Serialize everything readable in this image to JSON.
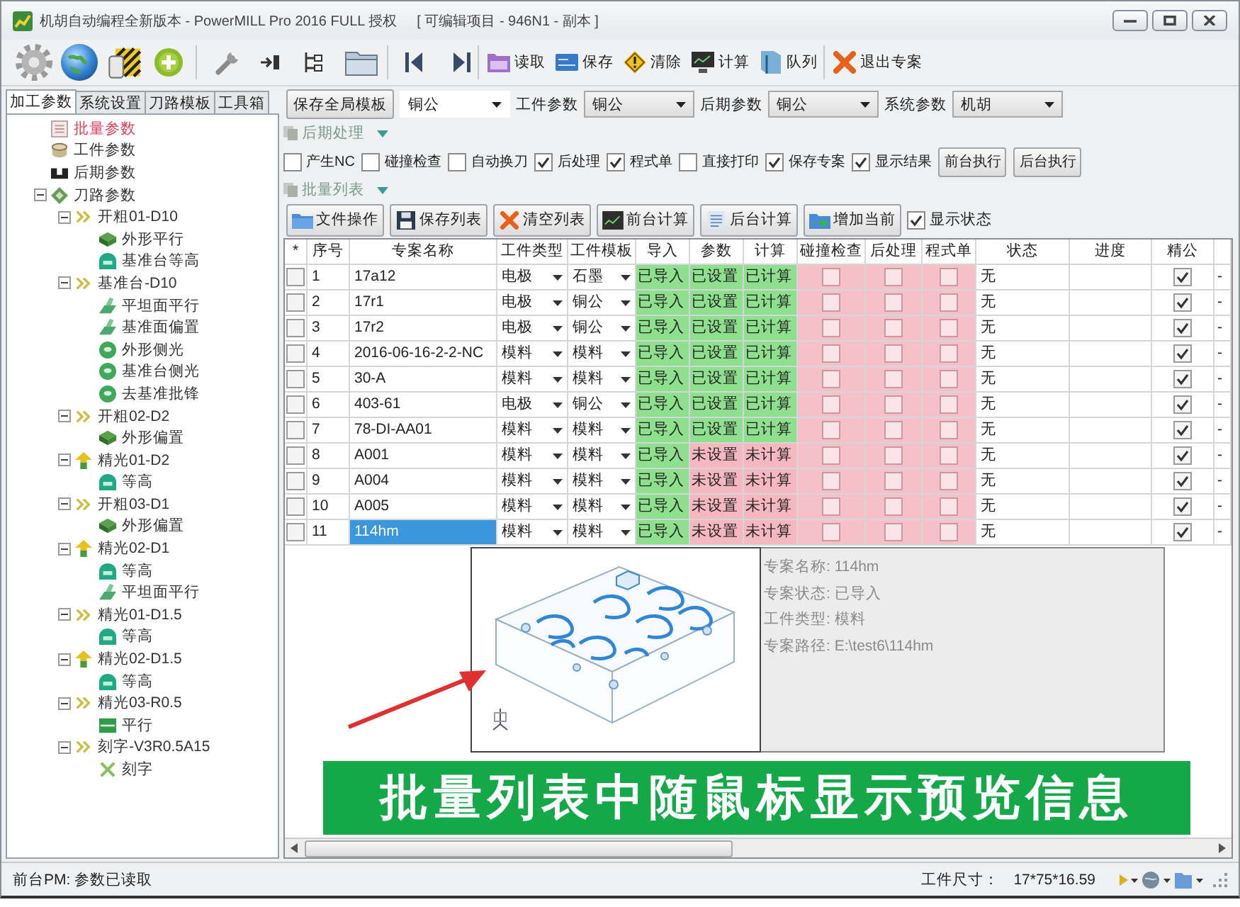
{
  "window": {
    "title": "机胡自动编程全新版本 - PowerMILL Pro 2016 FULL 授权",
    "subtitle": "[ 可编辑项目 - 946N1 - 副本 ]"
  },
  "toolbar": {
    "buttons": [
      {
        "label": "读取",
        "kind": "open"
      },
      {
        "label": "保存",
        "kind": "save"
      },
      {
        "label": "清除",
        "kind": "clear"
      },
      {
        "label": "计算",
        "kind": "compute"
      },
      {
        "label": "队列",
        "kind": "queue"
      },
      {
        "label": "退出专案",
        "kind": "exit"
      }
    ]
  },
  "left_tabs": [
    {
      "label": "加工参数",
      "selected": true
    },
    {
      "label": "系统设置",
      "selected": false
    },
    {
      "label": "刀路模板",
      "selected": false
    },
    {
      "label": "工具箱",
      "selected": false
    }
  ],
  "tree": [
    {
      "label": "批量参数",
      "kind": "batch",
      "selected": true
    },
    {
      "label": "工件参数",
      "kind": "workpiece",
      "selected": false
    },
    {
      "label": "后期参数",
      "kind": "post",
      "selected": false
    },
    {
      "label": "刀路参数",
      "kind": "toolpath",
      "selected": false,
      "expanded": true,
      "children": [
        {
          "label": "开粗01-D10",
          "kind": "rough",
          "selected": false,
          "expanded": true,
          "children": [
            {
              "label": "外形平行",
              "kind": "layers",
              "selected": false
            },
            {
              "label": "基准台等高",
              "kind": "dome",
              "selected": false
            }
          ]
        },
        {
          "label": "基准台-D10",
          "kind": "rough",
          "selected": false,
          "expanded": true,
          "children": [
            {
              "label": "平坦面平行",
              "kind": "plane",
              "selected": false
            },
            {
              "label": "基准面偏置",
              "kind": "plane",
              "selected": false
            },
            {
              "label": "外形侧光",
              "kind": "ring",
              "selected": false
            },
            {
              "label": "基准台侧光",
              "kind": "ring",
              "selected": false
            },
            {
              "label": "去基准批锋",
              "kind": "ring",
              "selected": false
            }
          ]
        },
        {
          "label": "开粗02-D2",
          "kind": "rough",
          "selected": false,
          "expanded": true,
          "children": [
            {
              "label": "外形偏置",
              "kind": "layers",
              "selected": false
            }
          ]
        },
        {
          "label": "精光01-D2",
          "kind": "finish",
          "selected": false,
          "expanded": true,
          "children": [
            {
              "label": "等高",
              "kind": "dome",
              "selected": false
            }
          ]
        },
        {
          "label": "开粗03-D1",
          "kind": "rough",
          "selected": false,
          "expanded": true,
          "children": [
            {
              "label": "外形偏置",
              "kind": "layers",
              "selected": false
            }
          ]
        },
        {
          "label": "精光02-D1",
          "kind": "finish",
          "selected": false,
          "expanded": true,
          "children": [
            {
              "label": "等高",
              "kind": "dome",
              "selected": false
            },
            {
              "label": "平坦面平行",
              "kind": "plane",
              "selected": false
            }
          ]
        },
        {
          "label": "精光01-D1.5",
          "kind": "rough",
          "selected": false,
          "expanded": true,
          "children": [
            {
              "label": "等高",
              "kind": "dome",
              "selected": false
            }
          ]
        },
        {
          "label": "精光02-D1.5",
          "kind": "finish",
          "selected": false,
          "expanded": true,
          "children": [
            {
              "label": "等高",
              "kind": "dome",
              "selected": false
            }
          ]
        },
        {
          "label": "精光03-R0.5",
          "kind": "rough",
          "selected": false,
          "expanded": true,
          "children": [
            {
              "label": "平行",
              "kind": "panel",
              "selected": false
            }
          ]
        },
        {
          "label": "刻字-V3R0.5A15",
          "kind": "rough",
          "selected": false,
          "expanded": true,
          "children": [
            {
              "label": "刻字",
              "kind": "engrave",
              "selected": false
            }
          ]
        }
      ]
    }
  ],
  "template_bar": {
    "button": "保存全局模板",
    "selectors": [
      {
        "value": "铜公"
      },
      {
        "label": "工件参数",
        "value": "铜公"
      },
      {
        "label": "后期参数",
        "value": "铜公"
      },
      {
        "label": "系统参数",
        "value": "机胡"
      }
    ]
  },
  "post_section": {
    "title": "后期处理",
    "expanded": true,
    "options": [
      {
        "label": "产生NC",
        "checked": false
      },
      {
        "label": "碰撞检查",
        "checked": false
      },
      {
        "label": "自动换刀",
        "checked": false
      },
      {
        "label": "后处理",
        "checked": true
      },
      {
        "label": "程式单",
        "checked": true
      },
      {
        "label": "直接打印",
        "checked": false
      },
      {
        "label": "保存专案",
        "checked": true
      },
      {
        "label": "显示结果",
        "checked": true
      }
    ],
    "buttons": [
      "前台执行",
      "后台执行"
    ]
  },
  "batch_section": {
    "title": "批量列表",
    "expanded": true,
    "buttons": [
      {
        "label": "文件操作",
        "kind": "files"
      },
      {
        "label": "保存列表",
        "kind": "save"
      },
      {
        "label": "清空列表",
        "kind": "clear"
      },
      {
        "label": "前台计算",
        "kind": "foreground"
      },
      {
        "label": "后台计算",
        "kind": "background"
      },
      {
        "label": "增加当前",
        "kind": "add"
      }
    ],
    "show_status": {
      "label": "显示状态",
      "checked": true
    }
  },
  "table": {
    "columns": [
      "*",
      "序号",
      "专案名称",
      "工件类型",
      "工件模板",
      "导入",
      "参数",
      "计算",
      "碰撞检查",
      "后处理",
      "程式单",
      "状态",
      "进度",
      "精公"
    ],
    "rows": [
      {
        "checked": false,
        "no": "1",
        "name": "17a12",
        "selected": false,
        "type": "电极",
        "template": "石墨",
        "import": {
          "text": "已导入",
          "done": true
        },
        "params": {
          "text": "已设置",
          "done": true
        },
        "calc": {
          "text": "已计算",
          "done": true
        },
        "collision": false,
        "post": false,
        "program": false,
        "status": "无",
        "finish_electrode": true,
        "column_15": "-"
      },
      {
        "checked": false,
        "no": "2",
        "name": "17r1",
        "selected": false,
        "type": "电极",
        "template": "铜公",
        "import": {
          "text": "已导入",
          "done": true
        },
        "params": {
          "text": "已设置",
          "done": true
        },
        "calc": {
          "text": "已计算",
          "done": true
        },
        "collision": false,
        "post": false,
        "program": false,
        "status": "无",
        "finish_electrode": true,
        "column_15": "-"
      },
      {
        "checked": false,
        "no": "3",
        "name": "17r2",
        "selected": false,
        "type": "电极",
        "template": "铜公",
        "import": {
          "text": "已导入",
          "done": true
        },
        "params": {
          "text": "已设置",
          "done": true
        },
        "calc": {
          "text": "已计算",
          "done": true
        },
        "collision": false,
        "post": false,
        "program": false,
        "status": "无",
        "finish_electrode": true,
        "column_15": "-"
      },
      {
        "checked": false,
        "no": "4",
        "name": "2016-06-16-2-2-NC",
        "selected": false,
        "type": "模料",
        "template": "模料",
        "import": {
          "text": "已导入",
          "done": true
        },
        "params": {
          "text": "已设置",
          "done": true
        },
        "calc": {
          "text": "已计算",
          "done": true
        },
        "collision": false,
        "post": false,
        "program": false,
        "status": "无",
        "finish_electrode": true,
        "column_15": "-"
      },
      {
        "checked": false,
        "no": "5",
        "name": "30-A",
        "selected": false,
        "type": "模料",
        "template": "模料",
        "import": {
          "text": "已导入",
          "done": true
        },
        "params": {
          "text": "已设置",
          "done": true
        },
        "calc": {
          "text": "已计算",
          "done": true
        },
        "collision": false,
        "post": false,
        "program": false,
        "status": "无",
        "finish_electrode": true,
        "column_15": "-"
      },
      {
        "checked": false,
        "no": "6",
        "name": "403-61",
        "selected": false,
        "type": "电极",
        "template": "铜公",
        "import": {
          "text": "已导入",
          "done": true
        },
        "params": {
          "text": "已设置",
          "done": true
        },
        "calc": {
          "text": "已计算",
          "done": true
        },
        "collision": false,
        "post": false,
        "program": false,
        "status": "无",
        "finish_electrode": true,
        "column_15": "-"
      },
      {
        "checked": false,
        "no": "7",
        "name": "78-DI-AA01",
        "selected": false,
        "type": "模料",
        "template": "模料",
        "import": {
          "text": "已导入",
          "done": true
        },
        "params": {
          "text": "已设置",
          "done": true
        },
        "calc": {
          "text": "已计算",
          "done": true
        },
        "collision": false,
        "post": false,
        "program": false,
        "status": "无",
        "finish_electrode": true,
        "column_15": "-"
      },
      {
        "checked": false,
        "no": "8",
        "name": "A001",
        "selected": false,
        "type": "模料",
        "template": "模料",
        "import": {
          "text": "已导入",
          "done": true
        },
        "params": {
          "text": "未设置",
          "done": false
        },
        "calc": {
          "text": "未计算",
          "done": false
        },
        "collision": false,
        "post": false,
        "program": false,
        "status": "无",
        "finish_electrode": true,
        "column_15": "-"
      },
      {
        "checked": false,
        "no": "9",
        "name": "A004",
        "selected": false,
        "type": "模料",
        "template": "模料",
        "import": {
          "text": "已导入",
          "done": true
        },
        "params": {
          "text": "未设置",
          "done": false
        },
        "calc": {
          "text": "未计算",
          "done": false
        },
        "collision": false,
        "post": false,
        "program": false,
        "status": "无",
        "finish_electrode": true,
        "column_15": "-"
      },
      {
        "checked": false,
        "no": "10",
        "name": "A005",
        "selected": false,
        "type": "模料",
        "template": "模料",
        "import": {
          "text": "已导入",
          "done": true
        },
        "params": {
          "text": "未设置",
          "done": false
        },
        "calc": {
          "text": "未计算",
          "done": false
        },
        "collision": false,
        "post": false,
        "program": false,
        "status": "无",
        "finish_electrode": true,
        "column_15": "-"
      },
      {
        "checked": false,
        "no": "11",
        "name": "114hm",
        "selected": true,
        "type": "模料",
        "template": "模料",
        "import": {
          "text": "已导入",
          "done": true
        },
        "params": {
          "text": "未设置",
          "done": false
        },
        "calc": {
          "text": "未计算",
          "done": false
        },
        "collision": false,
        "post": false,
        "program": false,
        "status": "无",
        "finish_electrode": true,
        "column_15": "-"
      }
    ]
  },
  "preview": {
    "info": [
      "专案名称: 114hm",
      "专案状态: 已导入",
      "工件类型: 模料",
      "专案路径: E:\\test6\\114hm"
    ]
  },
  "banner": "批量列表中随鼠标显示预览信息",
  "status_bar": {
    "message": "前台PM: 参数已读取",
    "size_label": "工件尺寸：",
    "size_value": "17*75*16.59"
  }
}
